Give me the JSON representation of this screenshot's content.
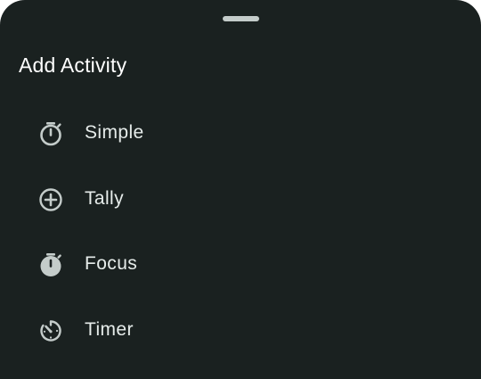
{
  "sheet": {
    "title": "Add Activity",
    "options": [
      {
        "label": "Simple",
        "icon": "stopwatch-outline-icon"
      },
      {
        "label": "Tally",
        "icon": "add-circle-outline-icon"
      },
      {
        "label": "Focus",
        "icon": "stopwatch-filled-icon"
      },
      {
        "label": "Timer",
        "icon": "timer-dial-icon"
      }
    ]
  },
  "colors": {
    "background": "#1a2120",
    "title_text": "#ffffff",
    "label_text": "#e6ecea",
    "icon": "#c4ccca",
    "drag_handle": "#c4ccca"
  }
}
